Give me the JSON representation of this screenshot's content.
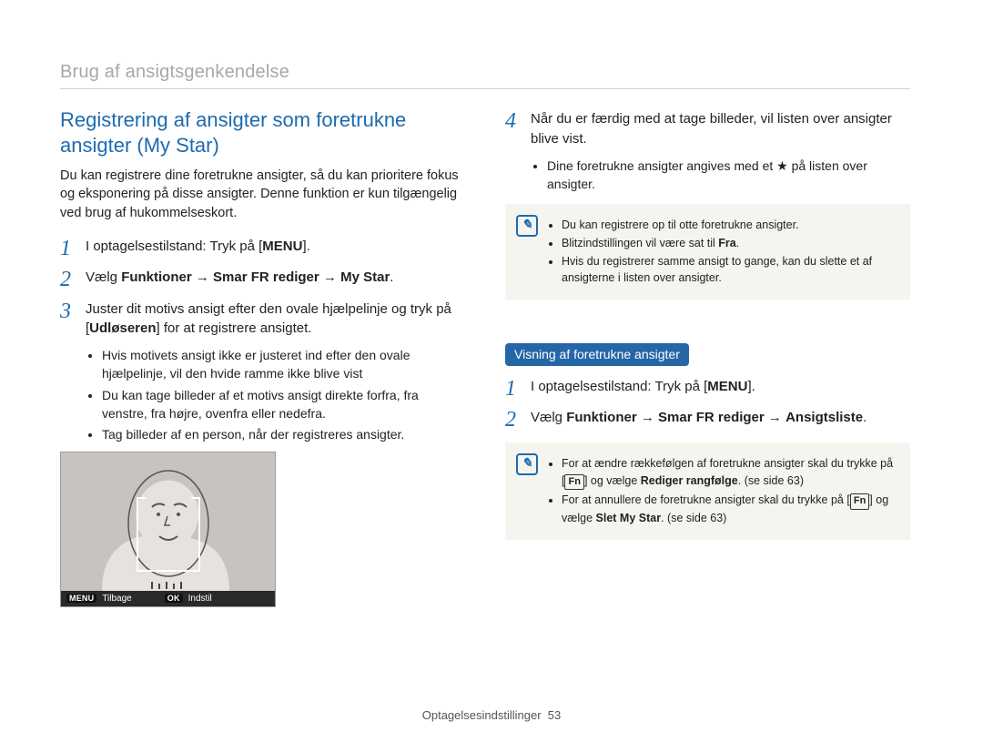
{
  "breadcrumb": "Brug af ansigtsgenkendelse",
  "section_title": "Registrering af ansigter som foretrukne ansigter (My Star)",
  "intro": "Du kan registrere dine foretrukne ansigter, så du kan prioritere fokus og eksponering på disse ansigter. Denne funktion er kun tilgængelig ved brug af hukommelseskort.",
  "steps_left": {
    "s1": {
      "num": "1",
      "prefix": "I optagelsestilstand: Tryk på [",
      "key": "MENU",
      "suffix": "]."
    },
    "s2": {
      "num": "2",
      "prefix": "Vælg ",
      "path1": "Funktioner",
      "path2": "Smar FR rediger",
      "path3": "My Star",
      "suffix": "."
    },
    "s3": {
      "num": "3",
      "text_a": "Juster dit motivs ansigt efter den ovale hjælpelinje og tryk på [",
      "key": "Udløseren",
      "text_b": "] for at registrere ansigtet."
    }
  },
  "bullets_left": [
    "Hvis motivets ansigt ikke er justeret ind efter den ovale hjælpelinje, vil den hvide ramme ikke blive vist",
    "Du kan tage billeder af et motivs ansigt direkte forfra, fra venstre, fra højre, ovenfra eller nedefra.",
    "Tag billeder af en person, når der registreres ansigter."
  ],
  "shot_bar": {
    "menu_key": "MENU",
    "menu_label": "Tilbage",
    "ok_key": "OK",
    "ok_label": "Indstil"
  },
  "steps_right": {
    "s4": {
      "num": "4",
      "text": "Når du er færdig med at tage billeder, vil listen over ansigter blive vist."
    }
  },
  "bullets_right_top": {
    "prefix": "Dine foretrukne ansigter angives med et ",
    "star": "★",
    "suffix": " på listen over ansigter."
  },
  "note1": {
    "li1": "Du kan registrere op til otte foretrukne ansigter.",
    "li2a": "Blitzindstillingen vil være sat til ",
    "li2b": "Fra",
    "li2c": ".",
    "li3": "Hvis du registrerer samme ansigt to gange, kan du slette et af ansigterne i listen over ansigter."
  },
  "pill": "Visning af foretrukne ansigter",
  "steps_right2": {
    "s1": {
      "num": "1",
      "prefix": "I optagelsestilstand: Tryk på [",
      "key": "MENU",
      "suffix": "]."
    },
    "s2": {
      "num": "2",
      "prefix": "Vælg ",
      "path1": "Funktioner",
      "path2": "Smar FR rediger",
      "path3": "Ansigtsliste",
      "suffix": "."
    }
  },
  "note2": {
    "li1a": "For at ændre rækkefølgen af foretrukne ansigter skal du trykke på [",
    "li1key": "Fn",
    "li1b": "] og vælge ",
    "li1bold": "Rediger rangfølge",
    "li1c": ". (se side 63)",
    "li2a": "For at annullere de foretrukne ansigter skal du trykke på [",
    "li2key": "Fn",
    "li2b": "] og vælge ",
    "li2bold": "Slet My Star",
    "li2c": ". (se side 63)"
  },
  "footer": {
    "label": "Optagelsesindstillinger",
    "page": "53"
  }
}
